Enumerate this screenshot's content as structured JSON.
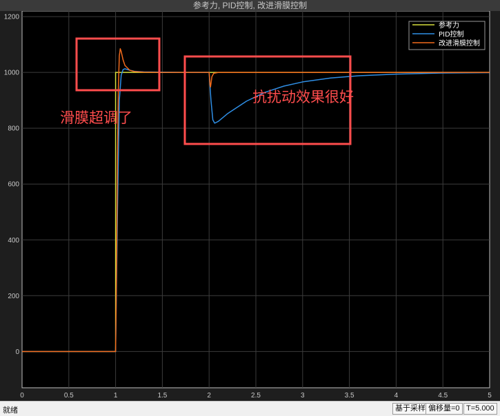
{
  "window": {
    "title": "参考力, PID控制, 改进滑膜控制"
  },
  "status_bar": {
    "ready": "就绪",
    "sample_mode": "基于采样",
    "offset": "偏移量=0",
    "time": "T=5.000"
  },
  "annotations": [
    {
      "label": "滑膜超调了",
      "color": "#ff4d4d"
    },
    {
      "label": "抗扰动效果很好",
      "color": "#ff4d4d"
    }
  ],
  "chart_data": {
    "type": "line",
    "title": "参考力, PID控制, 改进滑膜控制",
    "xlabel": "",
    "ylabel": "",
    "xlim": [
      0,
      5
    ],
    "ylim": [
      -130,
      1220
    ],
    "xticks": [
      0,
      0.5,
      1,
      1.5,
      2,
      2.5,
      3,
      3.5,
      4,
      4.5,
      5
    ],
    "xtick_labels": [
      "0",
      "0.5",
      "1",
      "1.5",
      "2",
      "2.5",
      "3",
      "3.5",
      "4",
      "4.5",
      "5"
    ],
    "yticks": [
      0,
      200,
      400,
      600,
      800,
      1000,
      1200
    ],
    "ytick_labels": [
      "0",
      "200",
      "400",
      "600",
      "800",
      "1000",
      "1200"
    ],
    "grid": true,
    "legend_position": "top-right",
    "series": [
      {
        "name": "参考力",
        "color": "#d7e03c",
        "x": [
          0,
          1.0,
          1.0,
          5
        ],
        "y": [
          0,
          0,
          1000,
          1000
        ]
      },
      {
        "name": "PID控制",
        "color": "#2f8fe6",
        "x": [
          0,
          1.0,
          1.02,
          1.04,
          1.06,
          1.08,
          1.1,
          1.15,
          1.2,
          1.3,
          1.5,
          1.7,
          1.9,
          2.0,
          2.02,
          2.04,
          2.06,
          2.1,
          2.2,
          2.4,
          2.6,
          2.8,
          3.0,
          3.3,
          3.6,
          4.0,
          4.5,
          5.0
        ],
        "y": [
          0,
          0,
          500,
          900,
          990,
          1010,
          1013,
          1008,
          1004,
          1002,
          1001,
          1000,
          1000,
          1000,
          900,
          830,
          818,
          825,
          853,
          897,
          929,
          951,
          966,
          980,
          988,
          994,
          998,
          999
        ]
      },
      {
        "name": "改进滑膜控制",
        "color": "#f36b1c",
        "x": [
          0,
          1.0,
          1.01,
          1.02,
          1.03,
          1.04,
          1.05,
          1.06,
          1.08,
          1.1,
          1.15,
          1.2,
          1.3,
          1.5,
          2.0,
          2.005,
          2.01,
          2.015,
          2.02,
          2.03,
          2.05,
          2.1,
          2.2,
          5.0
        ],
        "y": [
          0,
          0,
          300,
          700,
          950,
          1060,
          1085,
          1075,
          1045,
          1025,
          1008,
          1003,
          1001,
          1000,
          1000,
          980,
          955,
          948,
          960,
          985,
          997,
          1000,
          1000,
          1000
        ]
      }
    ]
  }
}
